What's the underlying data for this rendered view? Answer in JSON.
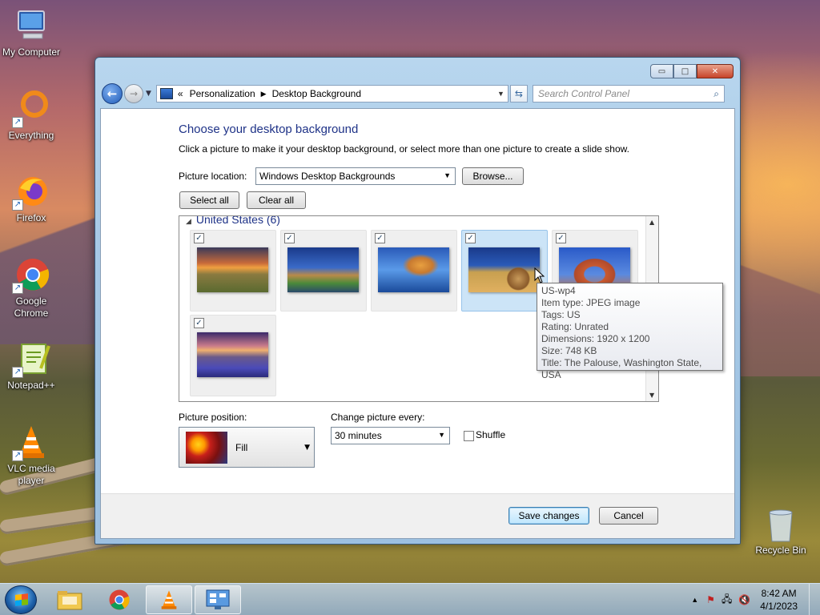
{
  "desktop": {
    "icons": [
      {
        "label": "My Computer"
      },
      {
        "label": "Everything"
      },
      {
        "label": "Firefox"
      },
      {
        "label": "Google Chrome"
      },
      {
        "label": "Notepad++"
      },
      {
        "label": "VLC media player"
      },
      {
        "label": "Recycle Bin"
      }
    ]
  },
  "window": {
    "controls": {
      "minimize": "▭",
      "maximize": "□",
      "close": "✕"
    },
    "breadcrumb": {
      "prefix": "«",
      "items": [
        "Personalization",
        "Desktop Background"
      ]
    },
    "search_placeholder": "Search Control Panel",
    "heading": "Choose your desktop background",
    "subtext": "Click a picture to make it your desktop background, or select more than one picture to create a slide show.",
    "picture_location": {
      "label": "Picture location:",
      "value": "Windows Desktop Backgrounds",
      "browse": "Browse..."
    },
    "select_all": "Select all",
    "clear_all": "Clear all",
    "group": {
      "title": "United States (6)",
      "count": 6
    },
    "thumbnails": [
      {
        "checked": true,
        "hover": false
      },
      {
        "checked": true,
        "hover": false
      },
      {
        "checked": true,
        "hover": false
      },
      {
        "checked": true,
        "hover": true
      },
      {
        "checked": true,
        "hover": false
      },
      {
        "checked": true,
        "hover": false
      }
    ],
    "tooltip": {
      "name": "US-wp4",
      "item_type": "Item type: JPEG image",
      "tags": "Tags: US",
      "rating": "Rating: Unrated",
      "dimensions": "Dimensions: 1920 x 1200",
      "size": "Size: 748 KB",
      "title": "Title: The Palouse, Washington State, USA"
    },
    "picture_position": {
      "label": "Picture position:",
      "value": "Fill"
    },
    "change_every": {
      "label": "Change picture every:",
      "value": "30 minutes"
    },
    "shuffle": {
      "label": "Shuffle",
      "checked": false
    },
    "save": "Save changes",
    "cancel": "Cancel"
  },
  "taskbar": {
    "time": "8:42 AM",
    "date": "4/1/2023"
  }
}
